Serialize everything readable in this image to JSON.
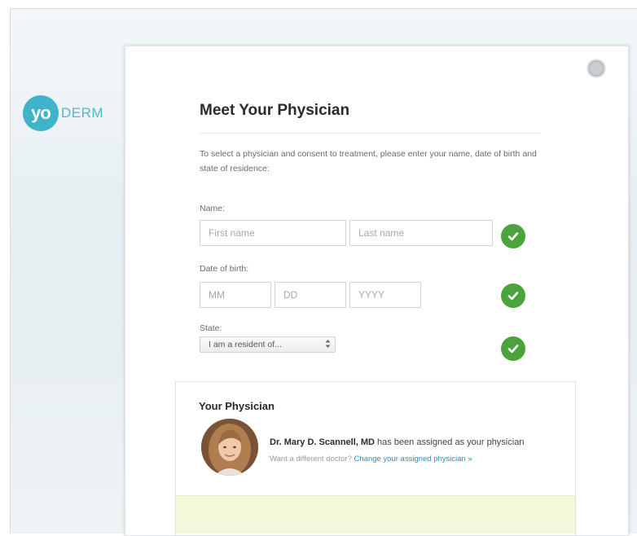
{
  "logo": {
    "mark": "yo",
    "rest": "DERM"
  },
  "modal": {
    "title": "Meet Your Physician",
    "intro": "To select a physician and consent to treatment, please enter your name, date of birth and state of residence:"
  },
  "form": {
    "name_label": "Name:",
    "first_name_placeholder": "First name",
    "last_name_placeholder": "Last name",
    "dob_label": "Date of birth:",
    "month_placeholder": "MM",
    "day_placeholder": "DD",
    "year_placeholder": "YYYY",
    "state_label": "State:",
    "state_select_value": "I am a resident of..."
  },
  "physician": {
    "heading": "Your Physician",
    "name": "Dr. Mary D. Scannell, MD",
    "assigned_text": " has been assigned as your physician",
    "different_prompt": "Want a different doctor?",
    "change_link": "Change your assigned physician »"
  },
  "colors": {
    "brand": "#3fb3c9",
    "check_green": "#4aa33b",
    "link": "#2a8fc1",
    "notice_bg": "#f6f8dc"
  },
  "icons": {
    "close": "close-icon",
    "check": "checkmark-icon",
    "select_arrows": "select-arrows-icon"
  }
}
